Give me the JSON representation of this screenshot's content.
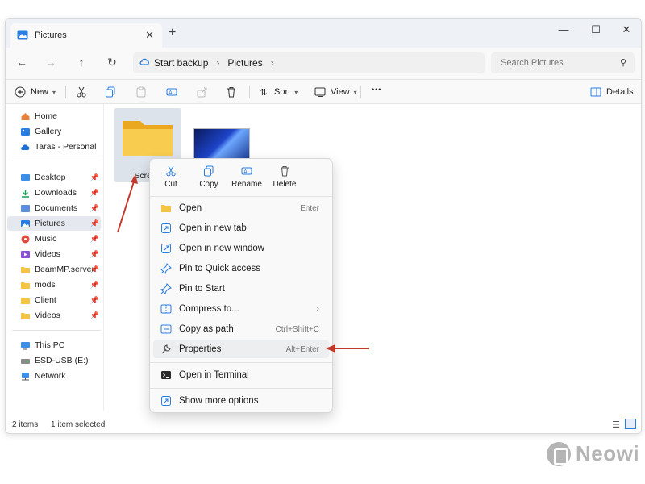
{
  "window": {
    "tab_title": "Pictures"
  },
  "address": {
    "items": [
      "Start backup",
      "Pictures"
    ]
  },
  "search": {
    "placeholder": "Search Pictures"
  },
  "toolbar": {
    "new_label": "New",
    "sort_label": "Sort",
    "view_label": "View",
    "more_label": "•••",
    "details_label": "Details"
  },
  "sidebar": {
    "quick": [
      {
        "label": "Home",
        "icon": "home-icon"
      },
      {
        "label": "Gallery",
        "icon": "gallery-icon"
      },
      {
        "label": "Taras - Personal",
        "icon": "onedrive-icon"
      }
    ],
    "pinned": [
      {
        "label": "Desktop",
        "icon": "desktop-icon"
      },
      {
        "label": "Downloads",
        "icon": "downloads-icon"
      },
      {
        "label": "Documents",
        "icon": "documents-icon"
      },
      {
        "label": "Pictures",
        "icon": "pictures-icon",
        "selected": true
      },
      {
        "label": "Music",
        "icon": "music-icon"
      },
      {
        "label": "Videos",
        "icon": "videos-icon"
      },
      {
        "label": "BeamMP.server",
        "icon": "folder-icon"
      },
      {
        "label": "mods",
        "icon": "folder-icon"
      },
      {
        "label": "Client",
        "icon": "folder-icon"
      },
      {
        "label": "Videos",
        "icon": "folder-icon"
      }
    ],
    "devices": [
      {
        "label": "This PC",
        "icon": "pc-icon"
      },
      {
        "label": "ESD-USB (E:)",
        "icon": "usb-drive-icon"
      },
      {
        "label": "Network",
        "icon": "network-icon"
      }
    ]
  },
  "content": {
    "folder_label": "Screen"
  },
  "status": {
    "items_count": "2 items",
    "selected": "1 item selected"
  },
  "context_menu": {
    "quick_actions": [
      {
        "label": "Cut",
        "icon": "cut-icon"
      },
      {
        "label": "Copy",
        "icon": "copy-icon"
      },
      {
        "label": "Rename",
        "icon": "rename-icon"
      },
      {
        "label": "Delete",
        "icon": "delete-icon"
      }
    ],
    "items": [
      {
        "label": "Open",
        "shortcut": "Enter",
        "icon": "folder-open-icon"
      },
      {
        "label": "Open in new tab",
        "shortcut": "",
        "icon": "new-tab-icon"
      },
      {
        "label": "Open in new window",
        "shortcut": "",
        "icon": "new-window-icon"
      },
      {
        "label": "Pin to Quick access",
        "shortcut": "",
        "icon": "pin-icon"
      },
      {
        "label": "Pin to Start",
        "shortcut": "",
        "icon": "pin-icon"
      },
      {
        "label": "Compress to...",
        "shortcut": "",
        "icon": "compress-icon",
        "submenu": true
      },
      {
        "label": "Copy as path",
        "shortcut": "Ctrl+Shift+C",
        "icon": "copy-path-icon"
      },
      {
        "label": "Properties",
        "shortcut": "Alt+Enter",
        "icon": "properties-icon"
      }
    ],
    "terminal": {
      "label": "Open in Terminal",
      "icon": "terminal-icon"
    },
    "more": {
      "label": "Show more options",
      "icon": "more-options-icon"
    }
  },
  "watermark": {
    "text": "Neowi"
  },
  "colors": {
    "accent": "#0067c0",
    "arrow": "#c0392b",
    "folder": "#f4c542"
  }
}
